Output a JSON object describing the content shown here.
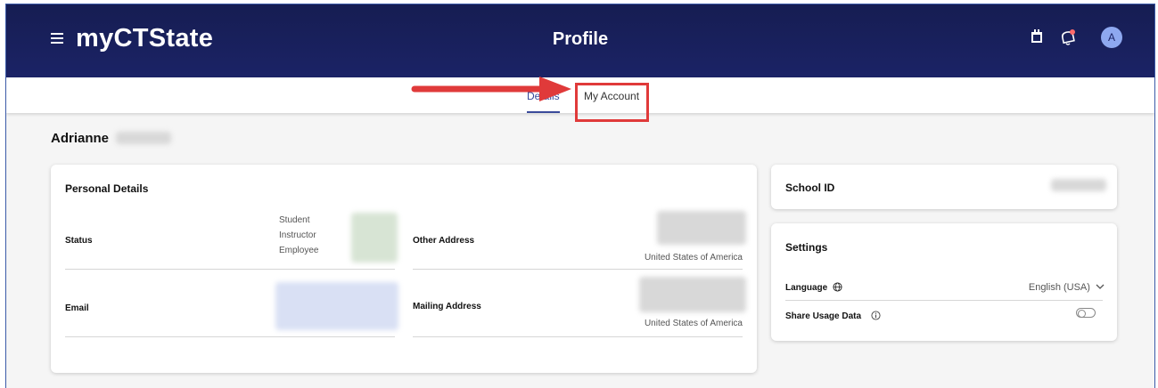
{
  "header": {
    "app_title": "myCTState",
    "page_title": "Profile",
    "avatar_initial": "A"
  },
  "tabs": [
    {
      "label": "Details",
      "active": true
    },
    {
      "label": "My Account",
      "active": false
    }
  ],
  "profile": {
    "first_name": "Adrianne"
  },
  "personal_details": {
    "title": "Personal Details",
    "status_label": "Status",
    "status_values": [
      "Student",
      "Instructor",
      "Employee"
    ],
    "email_label": "Email",
    "other_address_label": "Other Address",
    "other_address_country": "United States of America",
    "mailing_address_label": "Mailing Address",
    "mailing_address_country": "United States of America"
  },
  "school_id": {
    "title": "School ID"
  },
  "settings": {
    "title": "Settings",
    "language_label": "Language",
    "language_value": "English (USA)",
    "share_usage_label": "Share Usage Data"
  },
  "colors": {
    "header_bg": "#1b2366",
    "accent": "#3a4a9a",
    "annotation": "#e03a3a"
  },
  "icons": {
    "menu": "hamburger-icon",
    "calendar": "calendar-icon",
    "notifications": "bell-icon",
    "language": "globe-icon",
    "info": "info-icon",
    "dropdown": "chevron-down-icon",
    "annotation": "arrow-annotation"
  }
}
